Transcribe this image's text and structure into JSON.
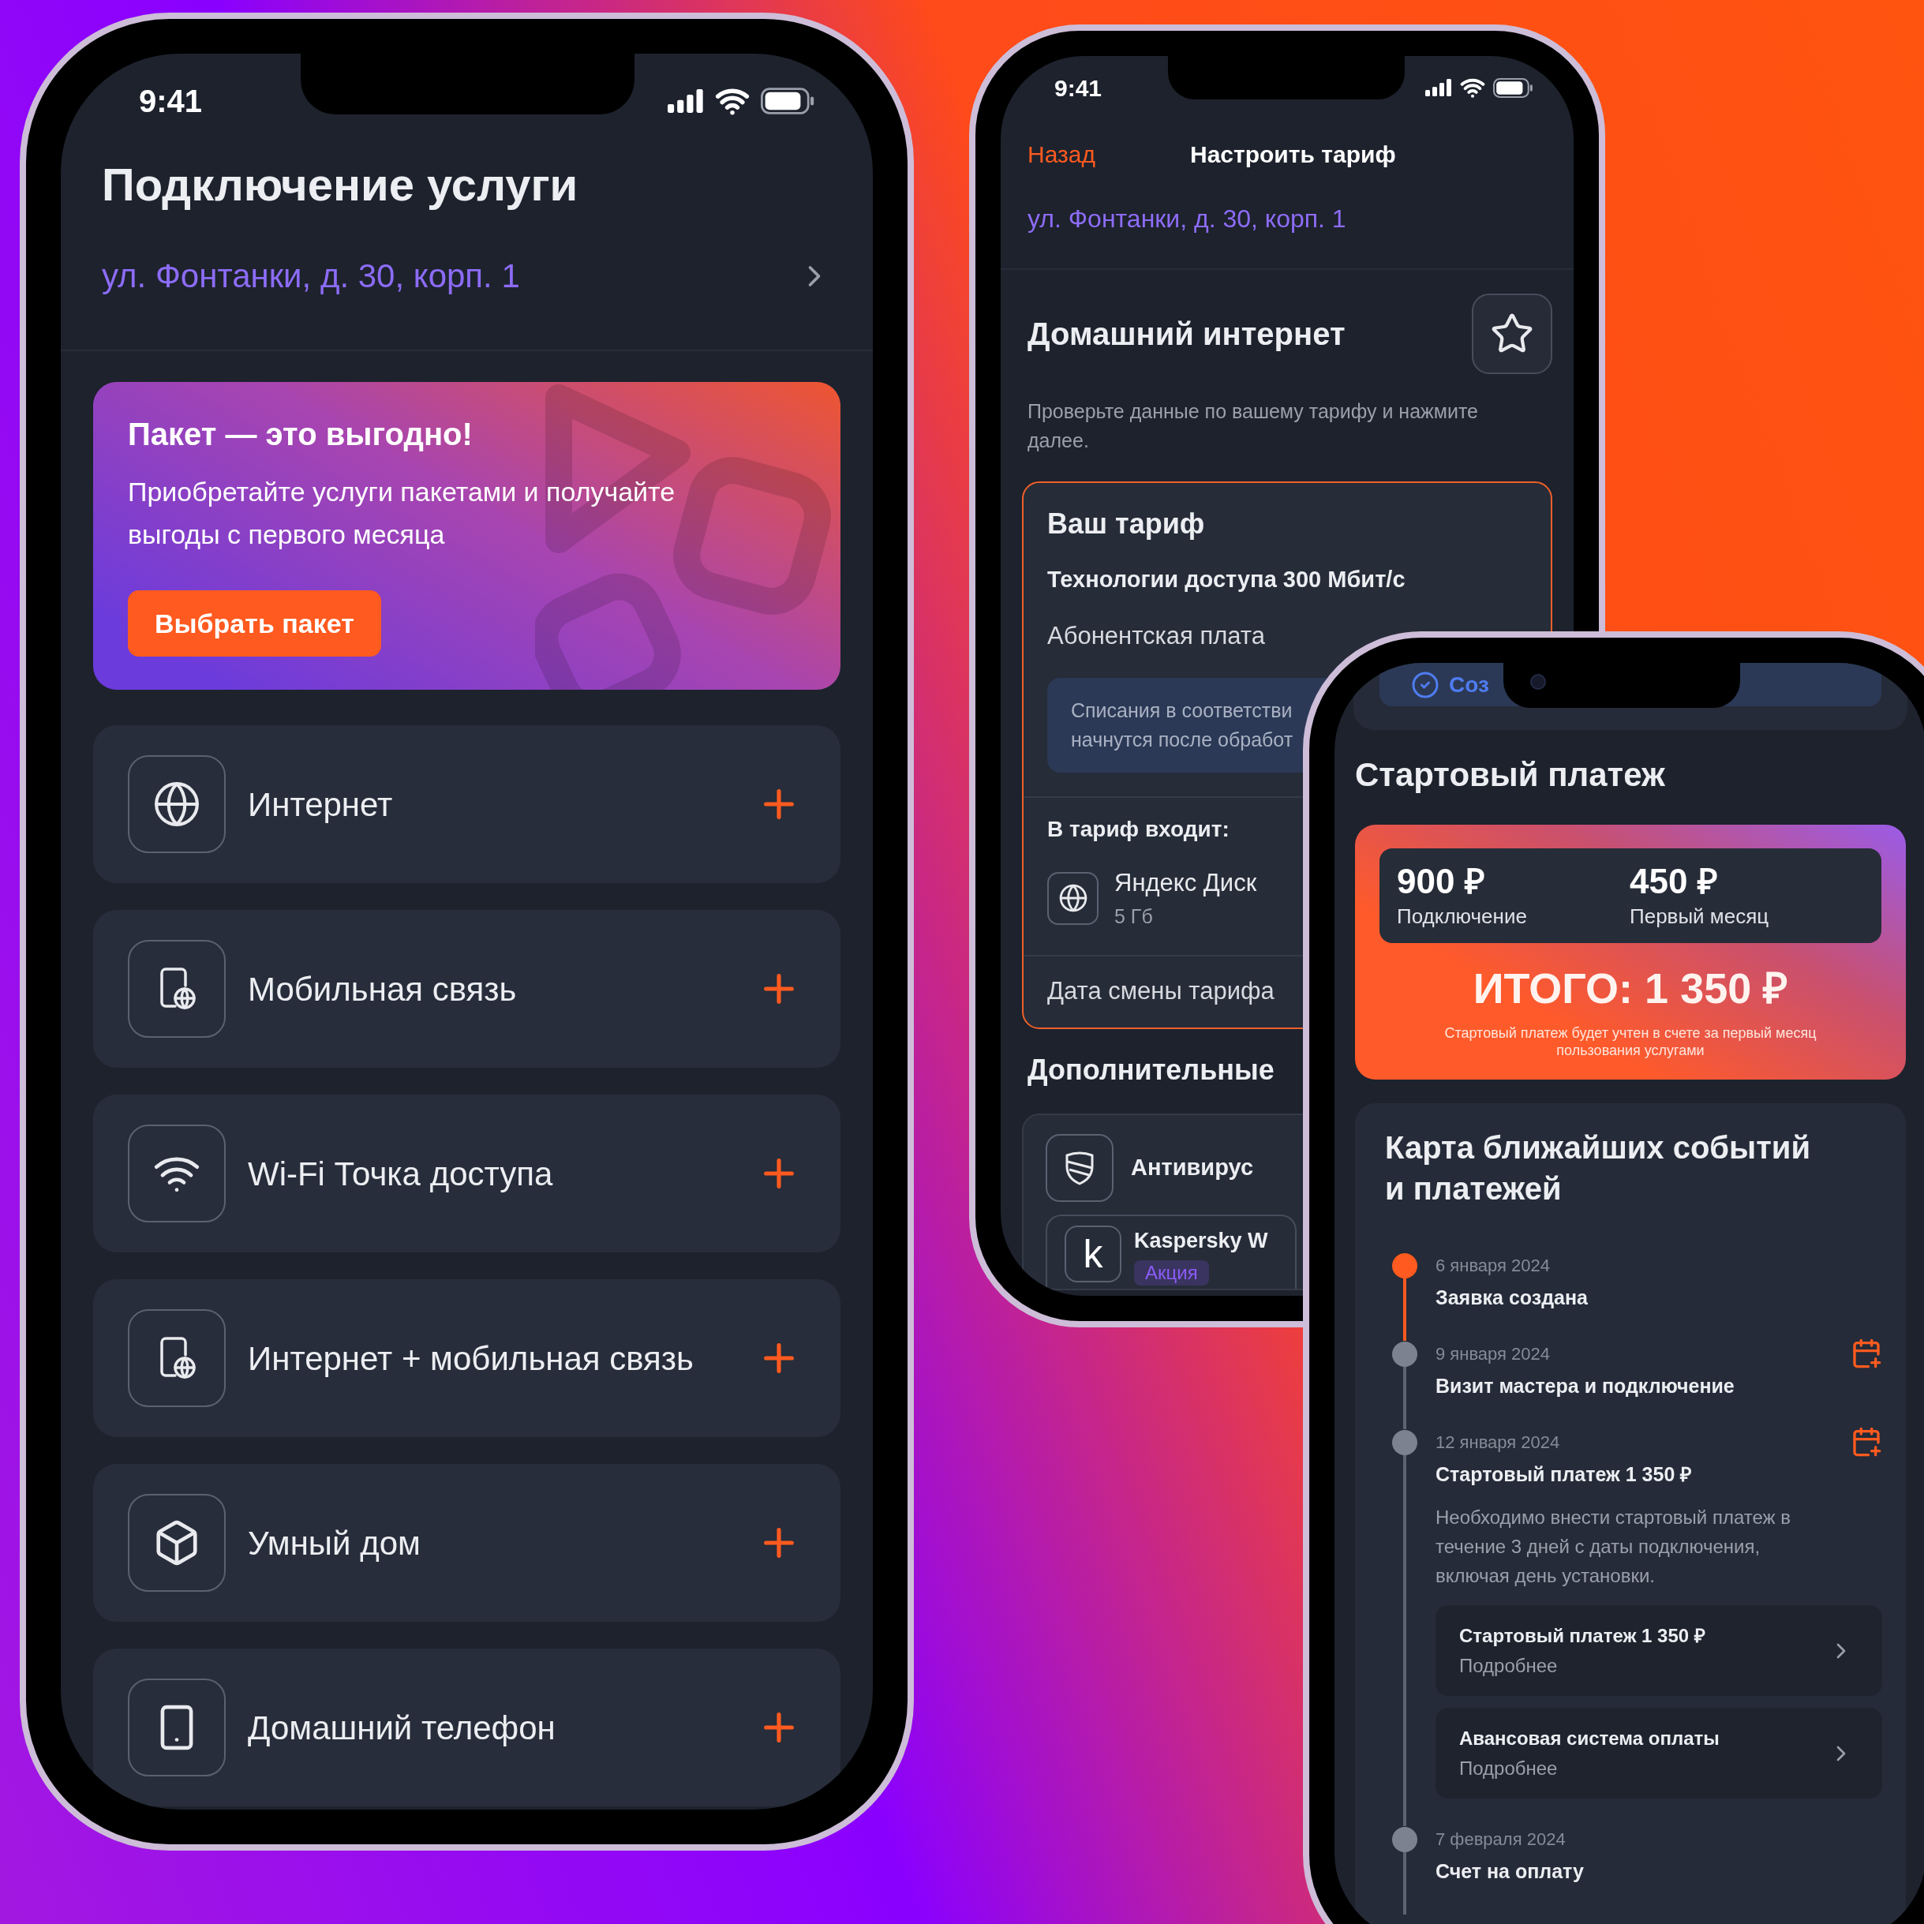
{
  "service_screen": {
    "status_bar": {
      "time": "9:41"
    },
    "title": "Подключение услуги",
    "address": "ул. Фонтанки, д. 30, корп. 1",
    "promo": {
      "title": "Пакет — это выгодно!",
      "text": "Приобретайте услуги пакетами и получайте\nвыгоды с первого месяца",
      "button": "Выбрать пакет"
    },
    "services": [
      {
        "kind": "internet",
        "label": "Интернет"
      },
      {
        "kind": "mobile",
        "label": "Мобильная связь"
      },
      {
        "kind": "wifi",
        "label": "Wi-Fi Точка доступа"
      },
      {
        "kind": "mobile",
        "label": "Интернет + мобильная связь"
      },
      {
        "kind": "smart_home",
        "label": "Умный дом"
      },
      {
        "kind": "home_phone",
        "label": "Домашний телефон"
      }
    ]
  },
  "tariff_screen": {
    "status_bar": {
      "time": "9:41"
    },
    "back": "Назад",
    "title": "Настроить тариф",
    "address": "ул. Фонтанки, д. 30, корп. 1",
    "section_title": "Домашний интернет",
    "description": "Проверьте данные по вашему тарифу и нажмите\nдалее.",
    "tariff_card": {
      "title": "Ваш тариф",
      "speed": "Технологии доступа 300 Мбит/с",
      "fee_label": "Абонентская плата",
      "notice_lines": [
        "Списания в соответстви",
        "начнутся после обработ"
      ],
      "includes_title": "В тариф входит:",
      "includes": [
        {
          "name": "Яндекс Диск",
          "detail": "5 Гб"
        }
      ],
      "change_date_label": "Дата смены тарифа"
    },
    "options_title": "Дополнительные",
    "options": [
      {
        "name": "Антивирус"
      }
    ],
    "promo_option": {
      "logo": "k",
      "name": "Kaspersky W",
      "badge": "Акция"
    }
  },
  "payment_screen": {
    "banner_text": "Соз",
    "title": "Стартовый платеж",
    "amounts": [
      {
        "value": "900 ₽",
        "label": "Подключение"
      },
      {
        "value": "450 ₽",
        "label": "Первый месяц"
      }
    ],
    "total": "ИТОГО: 1 350 ₽",
    "note": "Стартовый платеж будет учтен в счете за первый месяц\nпользования услугами",
    "events_title": "Карта ближайших событий\nи платежей",
    "events": [
      {
        "date": "6 января 2024",
        "title": "Заявка создана",
        "done": true,
        "calendar": false
      },
      {
        "date": "9 января 2024",
        "title": "Визит мастера и подключение",
        "done": false,
        "calendar": true
      },
      {
        "date": "12 января 2024",
        "title": "Стартовый платеж 1 350 ₽",
        "done": false,
        "calendar": true,
        "description": "Необходимо внести стартовый платеж в\nтечение 3 дней с даты подключения,\nвключая день установки.",
        "links": [
          {
            "title": "Стартовый платеж 1 350 ₽",
            "action": "Подробнее"
          },
          {
            "title": "Авансовая система оплаты",
            "action": "Подробнее"
          }
        ]
      },
      {
        "date": "7 февраля 2024",
        "title": "Счет на оплату",
        "done": false,
        "calendar": false
      }
    ]
  }
}
